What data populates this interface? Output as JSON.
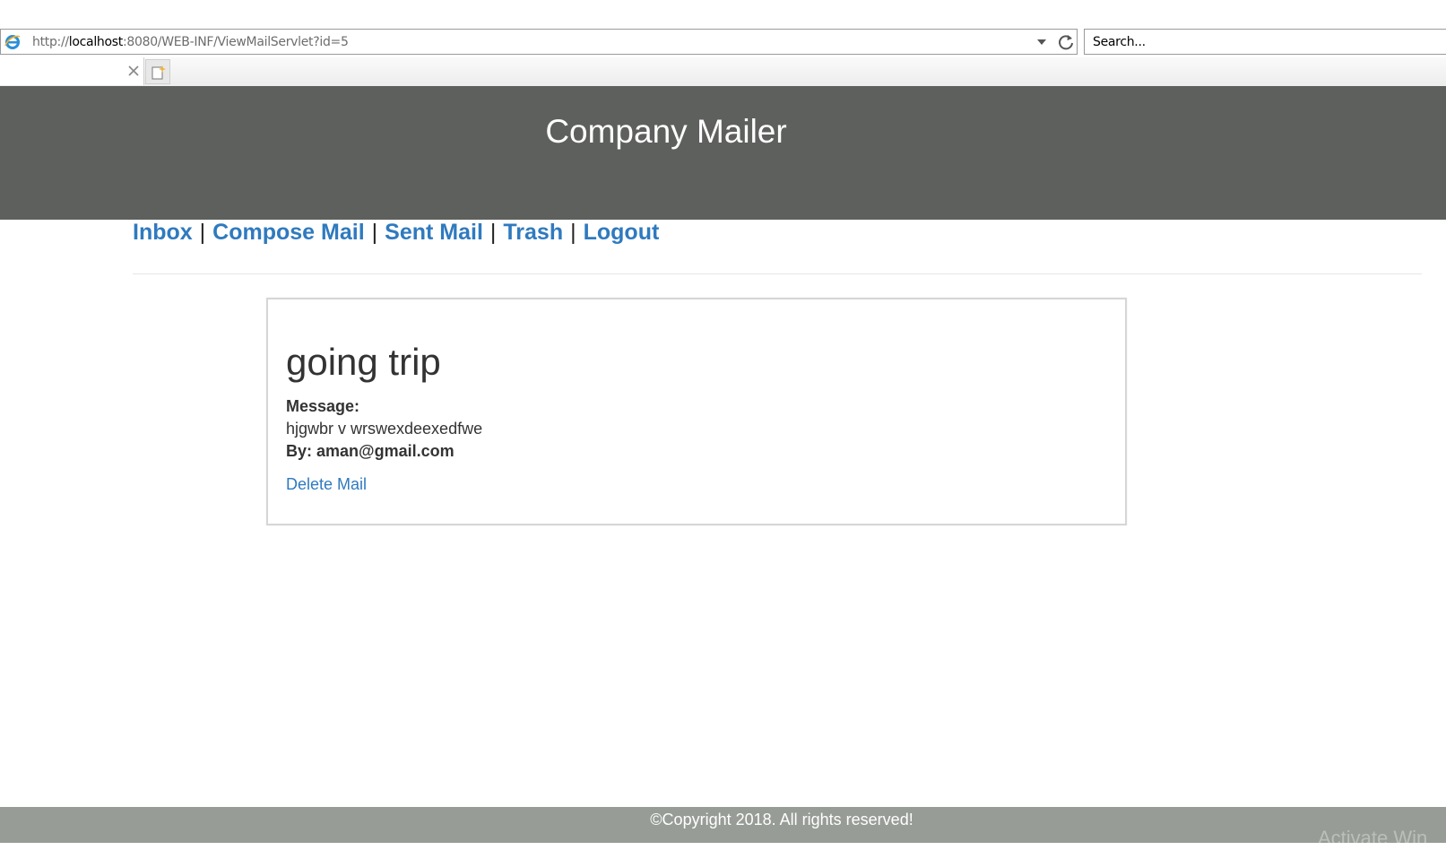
{
  "browser": {
    "address": {
      "prefix": "http://",
      "host": "localhost",
      "path": ":8080/WEB-INF/ViewMailServlet?id=5"
    },
    "search_placeholder": "Search...",
    "tab_close_icon": "close-icon",
    "new_tab_icon": "new-tab-icon"
  },
  "header": {
    "title": "Company Mailer"
  },
  "nav": {
    "items": [
      {
        "label": "Inbox"
      },
      {
        "label": "Compose Mail"
      },
      {
        "label": "Sent Mail"
      },
      {
        "label": "Trash"
      },
      {
        "label": "Logout"
      }
    ],
    "separator": "|"
  },
  "mail": {
    "subject": "going trip",
    "message_label": "Message:",
    "message_body": "hjgwbr v wrswexdeexedfwe",
    "by_text": "By: aman@gmail.com",
    "delete_label": "Delete Mail"
  },
  "footer": {
    "text": "©Copyright 2018. All rights reserved!"
  },
  "watermark": {
    "text": "Activate Win"
  },
  "colors": {
    "header_bg": "#5e605d",
    "footer_bg": "#979c96",
    "link": "#2f7abf"
  }
}
